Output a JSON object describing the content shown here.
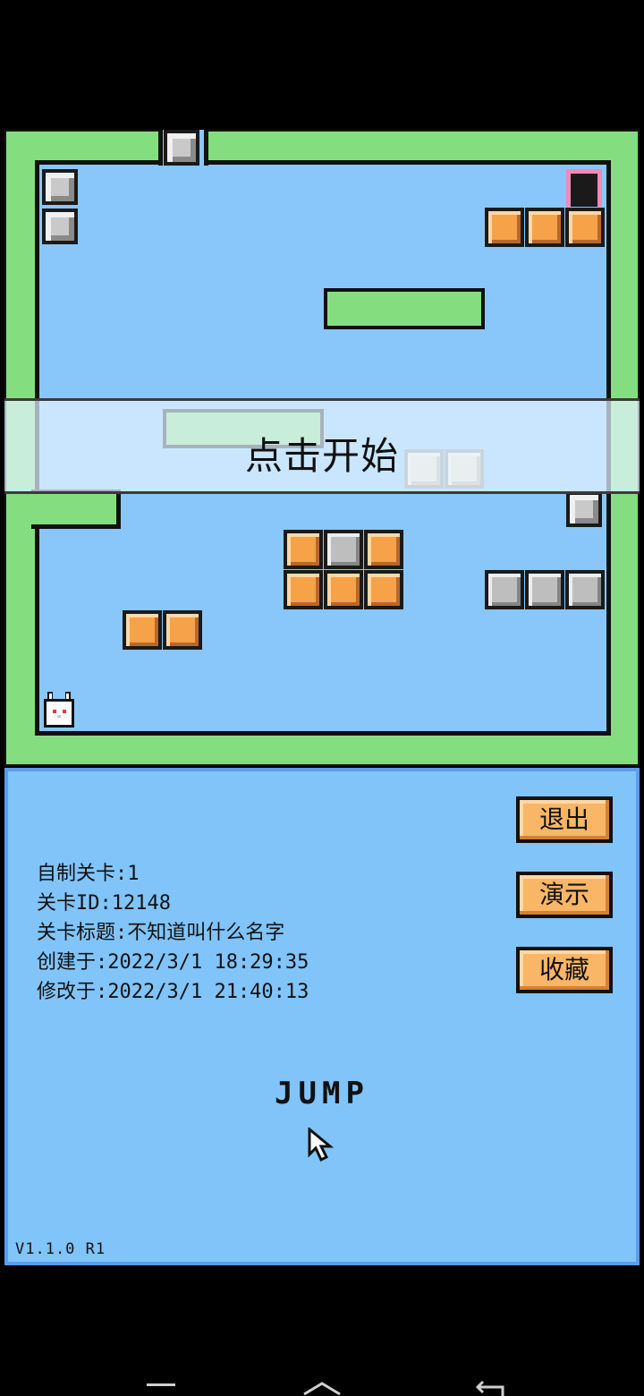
{
  "game": {
    "start_prompt": "点击开始"
  },
  "level_info": {
    "custom_level": "自制关卡:1",
    "level_id": "关卡ID:12148",
    "level_title": "关卡标题:不知道叫什么名字",
    "created_at": "创建于:2022/3/1 18:29:35",
    "modified_at": "修改于:2022/3/1 21:40:13"
  },
  "buttons": {
    "exit": "退出",
    "demo": "演示",
    "favorite": "收藏"
  },
  "logo": "JUMP",
  "version": "V1.1.0 R1",
  "icons": {
    "cursor": "pointer-cursor-icon",
    "player": "bunny-player-icon",
    "door": "exit-door-icon",
    "spike": "gray-spike-block-icon"
  },
  "colors": {
    "grass": "#84DE7F",
    "sky": "#89C7FA",
    "panel": "#80C4FA",
    "orange_block": "#F5A248",
    "gray_block": "#BEBEBE",
    "door_frame": "#F08AB6"
  }
}
